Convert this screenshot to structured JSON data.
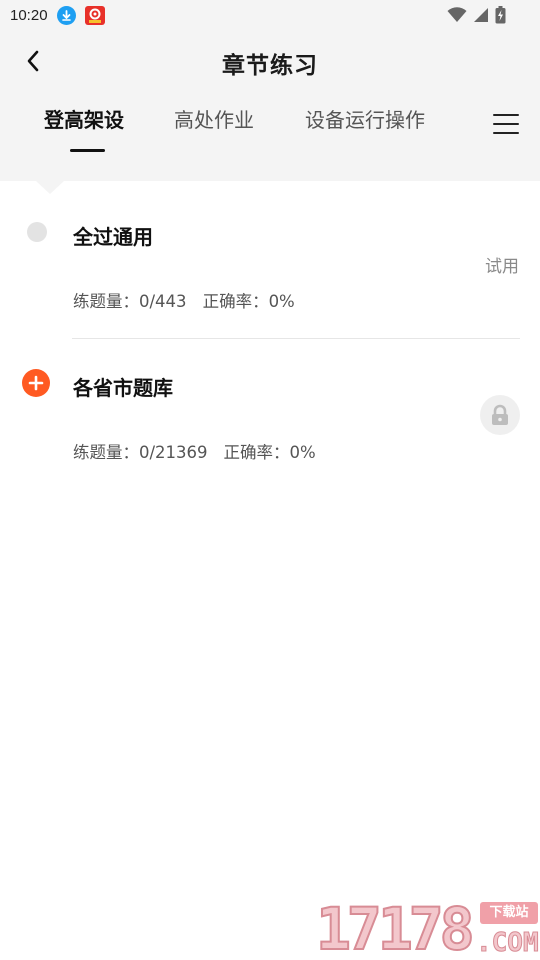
{
  "status_bar": {
    "time": "10:20"
  },
  "header": {
    "title": "章节练习"
  },
  "tabs": [
    {
      "label": "登高架设",
      "active": true
    },
    {
      "label": "高处作业",
      "active": false
    },
    {
      "label": "设备运行操作",
      "active": false
    }
  ],
  "items": [
    {
      "title": "全过通用",
      "badge": "试用",
      "stats_count": "练题量：0/443",
      "stats_accuracy": "正确率：0%",
      "dot": "grey-dot",
      "locked": false
    },
    {
      "title": "各省市题库",
      "stats_count": "练题量：0/21369",
      "stats_accuracy": "正确率：0%",
      "dot": "plus-icon",
      "locked": true
    }
  ],
  "watermark": {
    "digits": "17178",
    "tag": "下载站",
    "domain": ".COM"
  },
  "colors": {
    "accent": "#ff5a22",
    "header_bg": "#f4f4f4",
    "download_notification": "#1e9ff2",
    "app_notification": "#e8312a"
  }
}
